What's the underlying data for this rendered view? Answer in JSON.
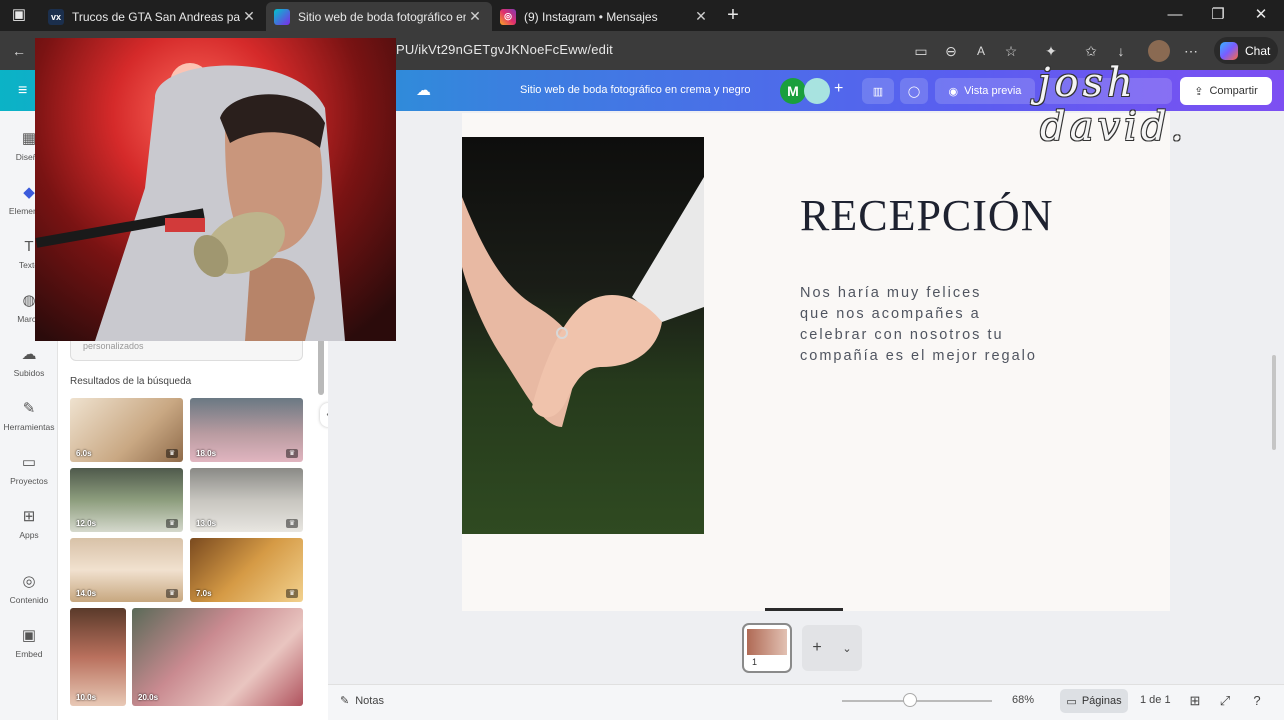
{
  "browser": {
    "tabs": [
      {
        "label": "Trucos de GTA San Andreas para PC",
        "active": false,
        "icon": "vx-icon"
      },
      {
        "label": "Sitio web de boda fotográfico en crema y negro",
        "active": true,
        "icon": "canva-icon"
      },
      {
        "label": "(9) Instagram • Mensajes",
        "active": false,
        "icon": "instagram-icon"
      }
    ],
    "url": "PU/ikVt29nGETgvJKNoeFcEww/edit",
    "chat_label": "Chat"
  },
  "header": {
    "doc_title": "Sitio web de boda fotográfico en crema y negro",
    "avatar_letter": "M",
    "preview_label": "Vista previa",
    "share_label": "Compartir"
  },
  "rail": {
    "items": [
      {
        "label": "Diseño",
        "icon": "layout-icon"
      },
      {
        "label": "Elementos",
        "icon": "elements-icon"
      },
      {
        "label": "Texto",
        "icon": "text-icon"
      },
      {
        "label": "Marca",
        "icon": "brand-icon"
      },
      {
        "label": "Subidos",
        "icon": "upload-cloud-icon"
      },
      {
        "label": "Herramientas",
        "icon": "tools-icon"
      },
      {
        "label": "Proyectos",
        "icon": "folder-icon"
      },
      {
        "label": "Apps",
        "icon": "apps-icon"
      },
      {
        "label": "Contenido",
        "icon": "content-icon"
      },
      {
        "label": "Embed",
        "icon": "embed-icon"
      }
    ]
  },
  "panel": {
    "input_partial": "personalizados",
    "results_title": "Resultados de la búsqueda",
    "videos": [
      {
        "duration": "6.0s"
      },
      {
        "duration": "18.0s"
      },
      {
        "duration": "12.0s"
      },
      {
        "duration": "13.0s"
      },
      {
        "duration": "14.0s"
      },
      {
        "duration": "7.0s"
      },
      {
        "duration": "10.0s"
      },
      {
        "duration": "20.0s"
      }
    ]
  },
  "canvas": {
    "title": "RECEPCIÓN",
    "body_lines": [
      "Nos haría muy felices",
      "que nos acompañes a",
      "celebrar con nosotros tu",
      "compañía es el mejor regalo"
    ],
    "page_number": "1"
  },
  "footer": {
    "notes_label": "Notas",
    "zoom_label": "68%",
    "zoom_fraction": 0.45,
    "pages_label": "Páginas",
    "page_count": "1 de 1"
  },
  "watermark": {
    "line1": "josh",
    "line2": "david."
  },
  "colors": {
    "header_start": "#0bb3c6",
    "header_end": "#7d4ff2",
    "page_bg": "#faf8f6",
    "title": "#1e2230"
  }
}
